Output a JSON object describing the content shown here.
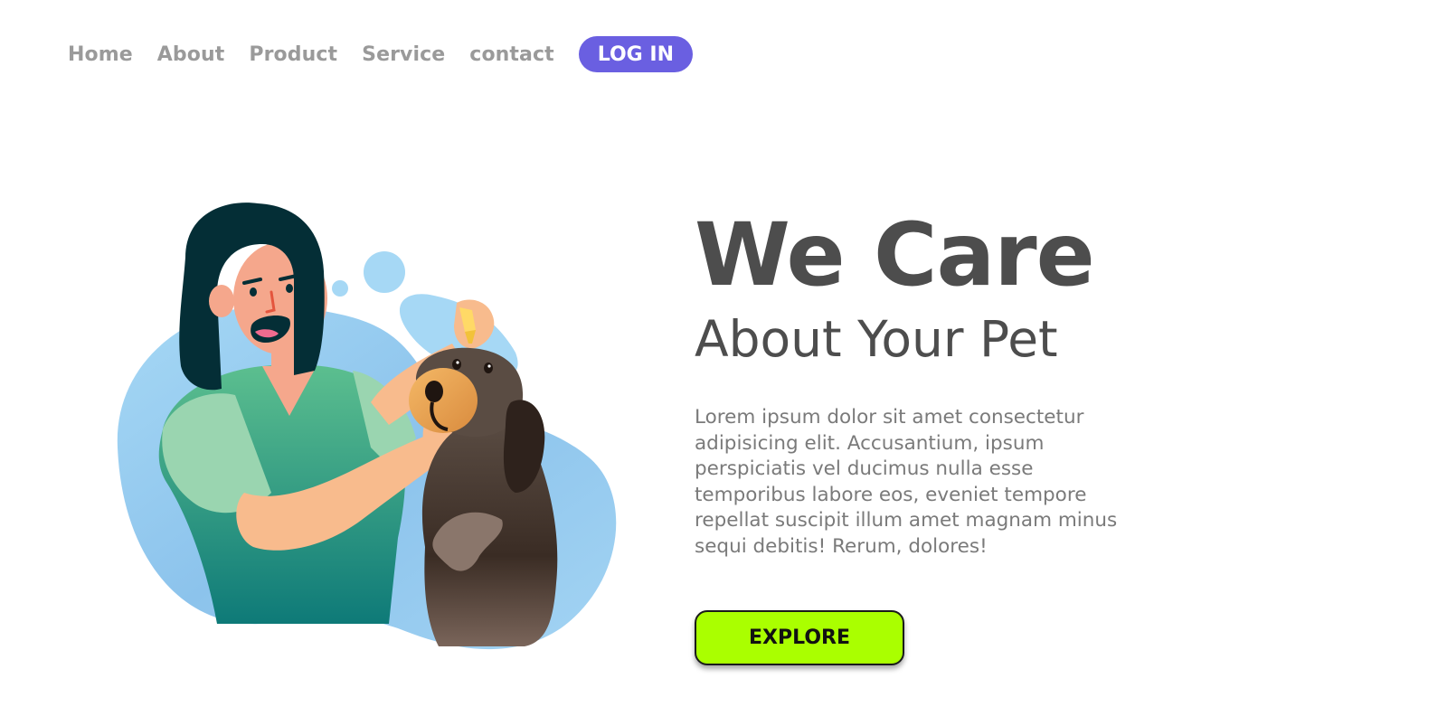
{
  "nav": {
    "links": [
      "Home",
      "About",
      "Product",
      "Service",
      "contact"
    ],
    "login_label": "LOG IN"
  },
  "hero": {
    "title": "We Care",
    "subtitle": "About Your Pet",
    "body": "Lorem ipsum dolor sit amet consectetur adipisicing elit. Accusantium, ipsum perspiciatis vel ducimus nulla esse temporibus labore eos, eveniet tempore repellat suscipit illum amet magnam minus sequi debitis! Rerum, dolores!",
    "cta_label": "EXPLORE"
  },
  "illustration": {
    "icon": "woman-giving-dog-eye-drops-illustration"
  },
  "colors": {
    "login_bg": "#6a5fe1",
    "cta_bg": "#aaff00",
    "heading": "#4d4d4d",
    "nav_text": "#9a9a9a",
    "body_text": "#7a7a7a"
  }
}
